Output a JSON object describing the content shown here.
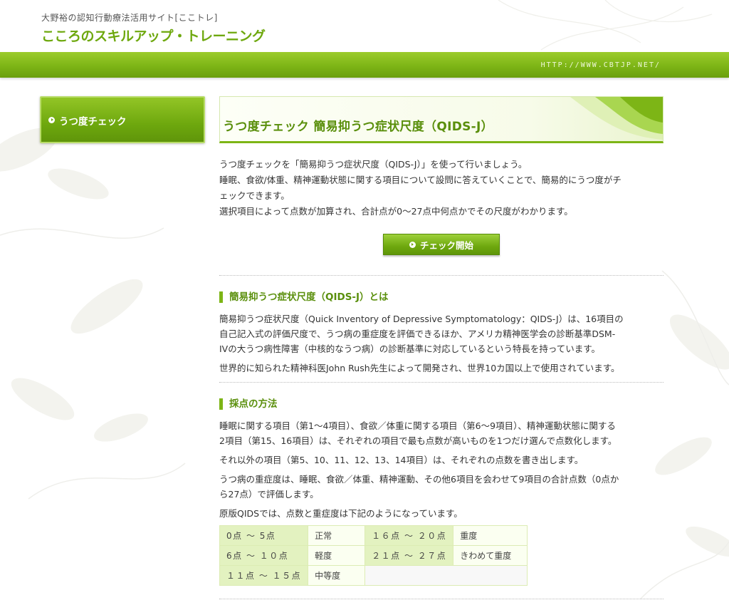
{
  "site": {
    "tagline": "大野裕の認知行動療法活用サイト[ここトレ]",
    "logo": "こころのスキルアップ・トレーニング",
    "url": "HTTP://WWW.CBTJP.NET/"
  },
  "sidebar": {
    "items": [
      {
        "label": "うつ度チェック"
      }
    ]
  },
  "main": {
    "title": "うつ度チェック 簡易抑うつ症状尺度（QIDS-J）",
    "intro": [
      "うつ度チェックを「簡易抑うつ症状尺度（QIDS-J）」を使って行いましょう。",
      "睡眠、食欲/体重、精神運動状態に関する項目について設問に答えていくことで、簡易的にうつ度がチ",
      "ェックできます。",
      "選択項目によって点数が加算され、合計点が0〜27点中何点かでその尺度がわかります。"
    ],
    "check_button": "チェック開始",
    "sections": [
      {
        "heading": "簡易抑うつ症状尺度（QIDS-J）とは",
        "paragraphs": [
          [
            "簡易抑うつ症状尺度（Quick Inventory of Depressive Symptomatology：QIDS-J）は、16項目の",
            "自己記入式の評価尺度で、うつ病の重症度を評価できるほか、アメリカ精神医学会の診断基準DSM-",
            "IVの大うつ病性障害（中核的なうつ病）の診断基準に対応しているという特長を持っています。"
          ],
          [
            "世界的に知られた精神科医John Rush先生によって開発され、世界10カ国以上で使用されています。"
          ]
        ]
      },
      {
        "heading": "採点の方法",
        "paragraphs": [
          [
            "睡眠に関する項目（第1〜4項目）、食欲／体重に関する項目（第6〜9項目）、精神運動状態に関する",
            "2項目（第15、16項目）は、それぞれの項目で最も点数が高いものを1つだけ選んで点数化します。"
          ],
          [
            "それ以外の項目（第5、10、11、12、13、14項目）は、それぞれの点数を書き出します。"
          ],
          [
            "うつ病の重症度は、睡眠、食欲／体重、精神運動、その他6項目を会わせて9項目の合計点数（0点か",
            "ら27点）で評価します。"
          ],
          [
            "原版QIDSでは、点数と重症度は下記のようになっています。"
          ]
        ]
      }
    ],
    "score_table": {
      "rows": [
        [
          {
            "range": "0点 〜 5点",
            "level": "正常"
          },
          {
            "range": "１６点 〜 ２０点",
            "level": "重度"
          }
        ],
        [
          {
            "range": "6点 〜 １０点",
            "level": "軽度"
          },
          {
            "range": "２１点 〜 ２７点",
            "level": "きわめて重度"
          }
        ],
        [
          {
            "range": "１１点 〜 １５点",
            "level": "中等度"
          }
        ]
      ]
    }
  }
}
